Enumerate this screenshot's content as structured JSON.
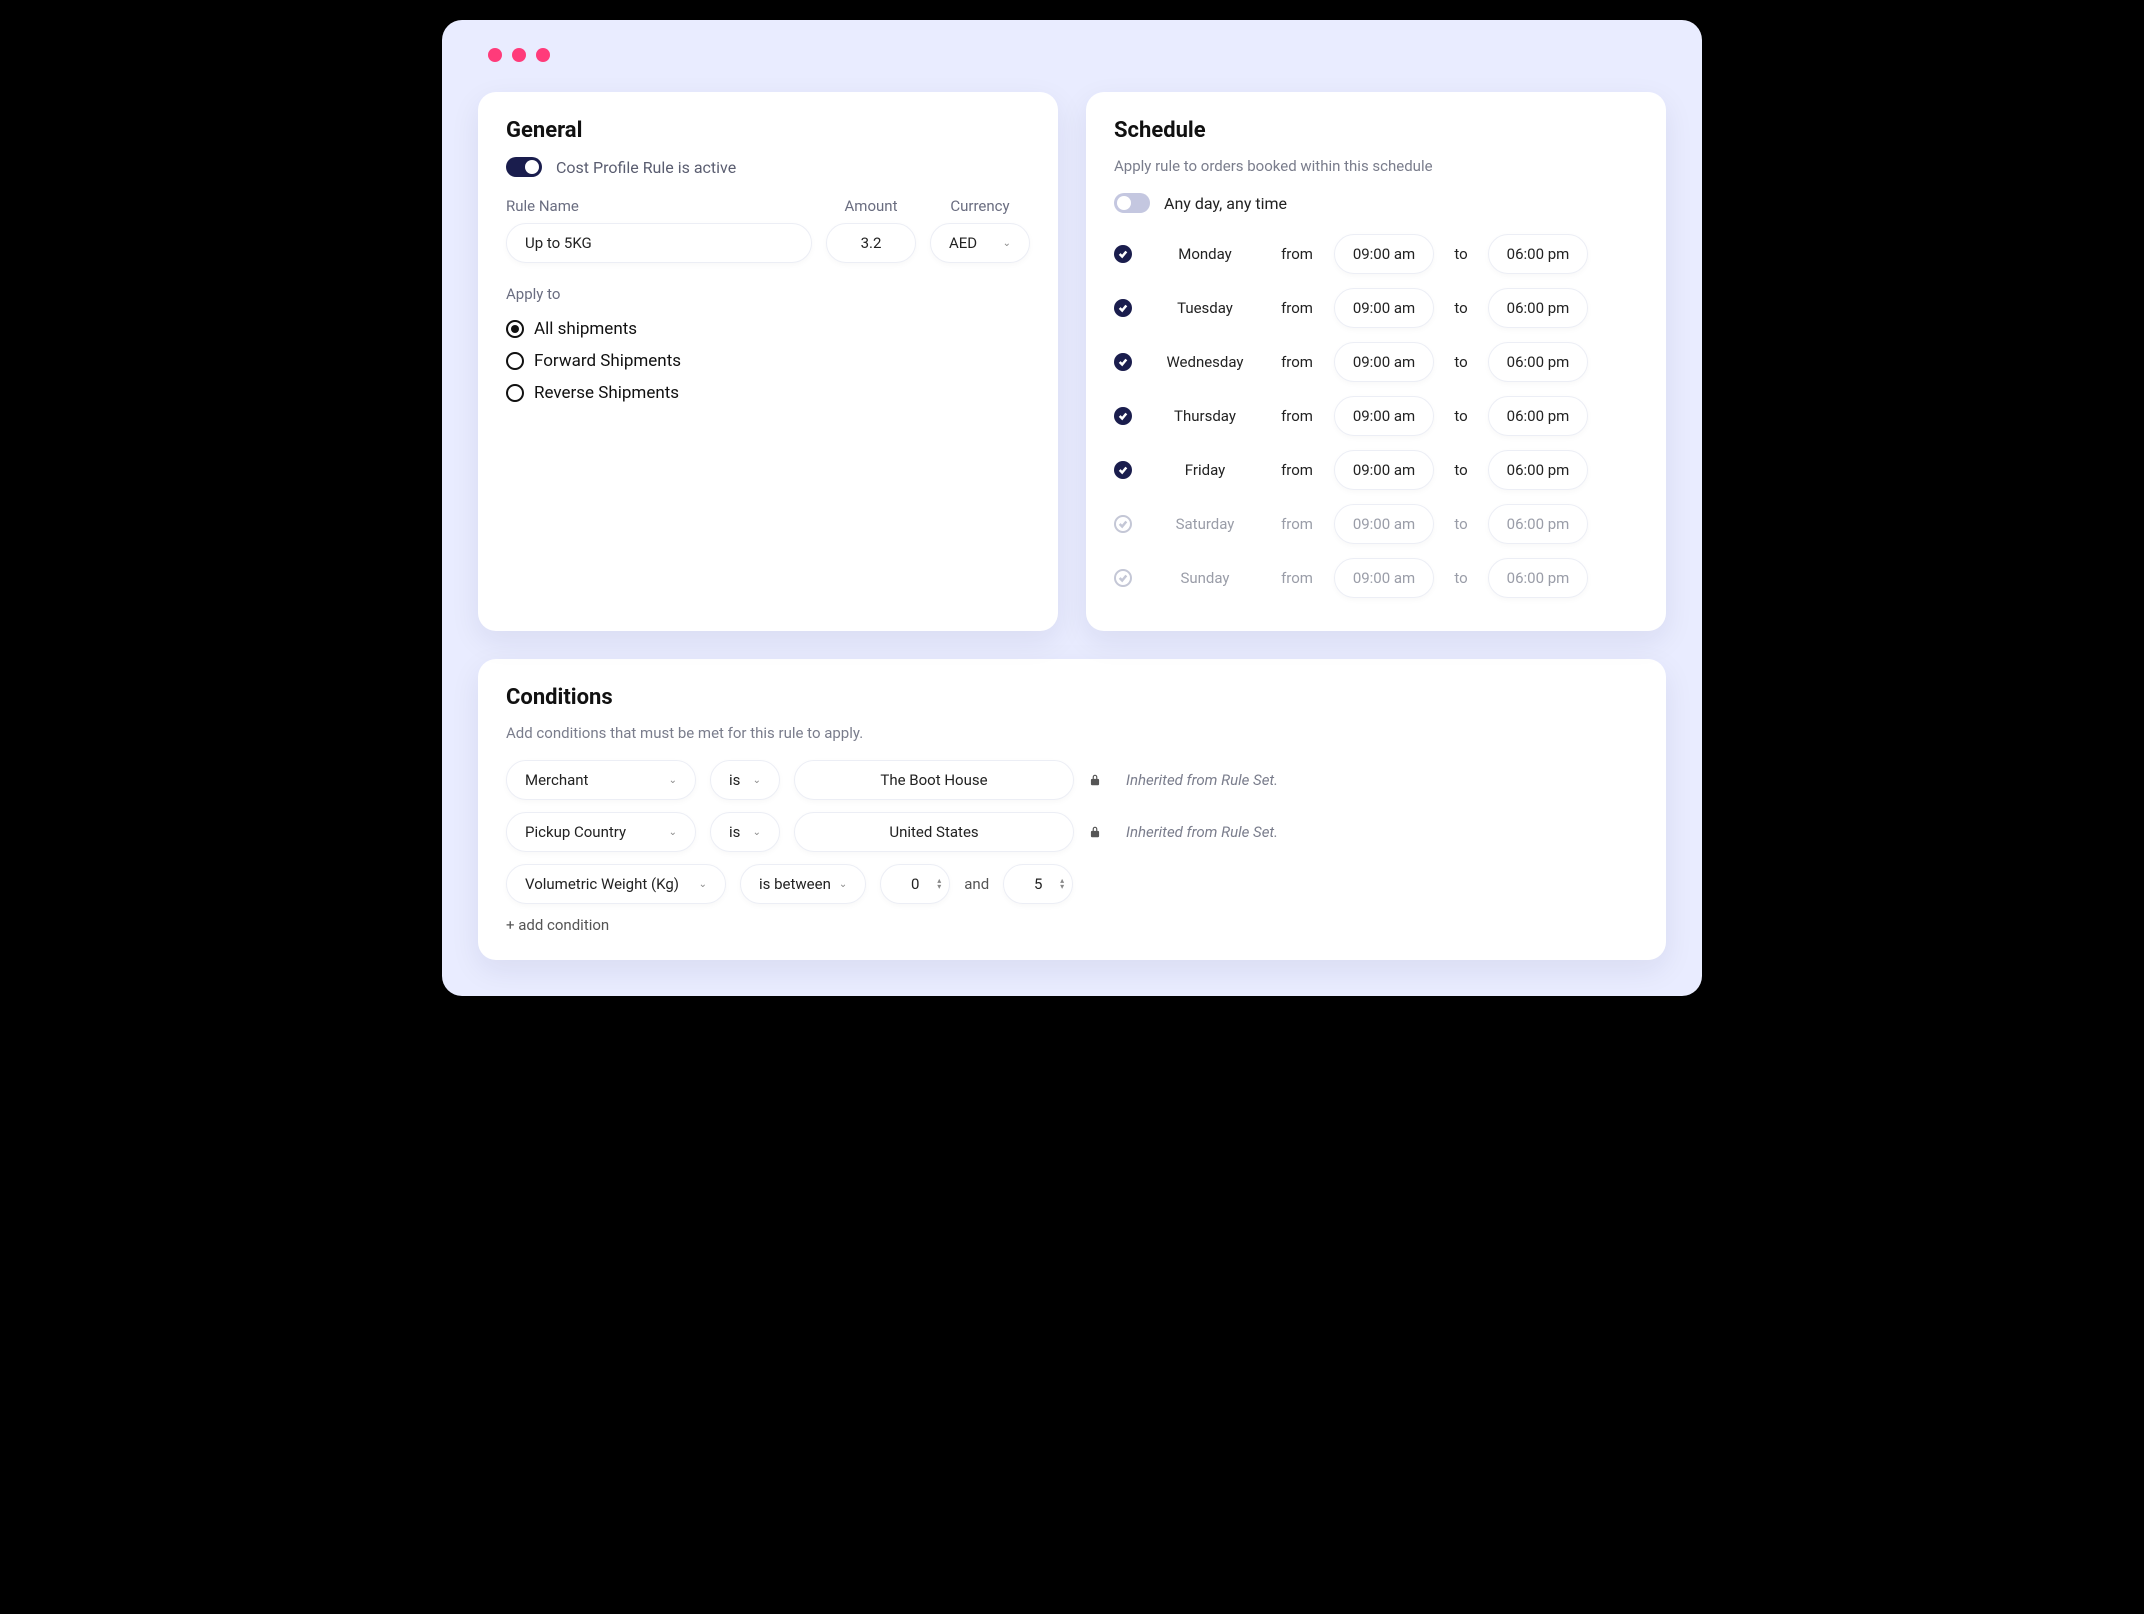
{
  "general": {
    "title": "General",
    "active_label": "Cost Profile Rule is active",
    "labels": {
      "rule_name": "Rule Name",
      "amount": "Amount",
      "currency": "Currency",
      "apply_to": "Apply to"
    },
    "rule_name": "Up to 5KG",
    "amount": "3.2",
    "currency": "AED",
    "apply_options": [
      {
        "label": "All shipments",
        "selected": true
      },
      {
        "label": "Forward Shipments",
        "selected": false
      },
      {
        "label": "Reverse Shipments",
        "selected": false
      }
    ]
  },
  "schedule": {
    "title": "Schedule",
    "subtitle": "Apply rule to orders booked within this schedule",
    "anyday_label": "Any day, any time",
    "from_label": "from",
    "to_label": "to",
    "days": [
      {
        "name": "Monday",
        "enabled": true,
        "from": "09:00 am",
        "to": "06:00 pm"
      },
      {
        "name": "Tuesday",
        "enabled": true,
        "from": "09:00 am",
        "to": "06:00 pm"
      },
      {
        "name": "Wednesday",
        "enabled": true,
        "from": "09:00 am",
        "to": "06:00 pm"
      },
      {
        "name": "Thursday",
        "enabled": true,
        "from": "09:00 am",
        "to": "06:00 pm"
      },
      {
        "name": "Friday",
        "enabled": true,
        "from": "09:00 am",
        "to": "06:00 pm"
      },
      {
        "name": "Saturday",
        "enabled": false,
        "from": "09:00 am",
        "to": "06:00 pm"
      },
      {
        "name": "Sunday",
        "enabled": false,
        "from": "09:00 am",
        "to": "06:00 pm"
      }
    ]
  },
  "conditions": {
    "title": "Conditions",
    "subtitle": "Add conditions that must be met for this rule to apply.",
    "inherited_label": "Inherited from Rule Set.",
    "and_label": "and",
    "add_label": "+ add condition",
    "rows": [
      {
        "field": "Merchant",
        "op": "is",
        "value": "The Boot House",
        "inherited": true
      },
      {
        "field": "Pickup Country",
        "op": "is",
        "value": "United States",
        "inherited": true
      }
    ],
    "range_row": {
      "field": "Volumetric Weight (Kg)",
      "op": "is between",
      "from": "0",
      "to": "5"
    }
  }
}
